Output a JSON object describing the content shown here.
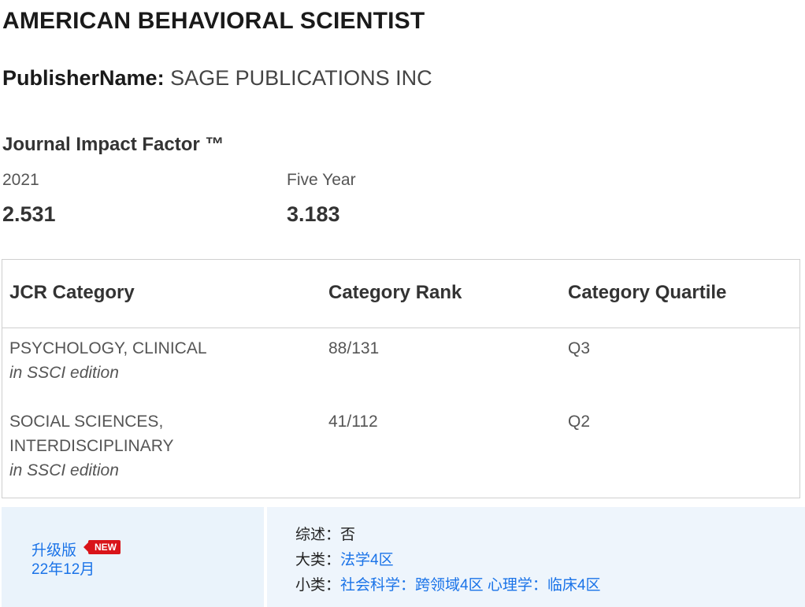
{
  "journal": {
    "title": "AMERICAN BEHAVIORAL SCIENTIST",
    "publisher_label": "PublisherName:",
    "publisher_value": "SAGE PUBLICATIONS INC"
  },
  "impact_factor": {
    "heading": "Journal Impact Factor ™",
    "current": {
      "label": "2021",
      "value": "2.531"
    },
    "five_year": {
      "label": "Five Year",
      "value": "3.183"
    }
  },
  "jcr_table": {
    "headers": [
      "JCR Category",
      "Category Rank",
      "Category Quartile"
    ],
    "rows": [
      {
        "category": "PSYCHOLOGY, CLINICAL",
        "edition": "in SSCI edition",
        "rank": "88/131",
        "quartile": "Q3"
      },
      {
        "category": "SOCIAL SCIENCES, INTERDISCIPLINARY",
        "edition": "in SSCI edition",
        "rank": "41/112",
        "quartile": "Q2"
      }
    ]
  },
  "cas_panel": {
    "upgrade_label": "升级版",
    "badge": "NEW",
    "date": "22年12月",
    "review_label": "综述：",
    "review_value": "否",
    "major_label": "大类：",
    "major_value": "法学4区",
    "minor_label": "小类：",
    "minor_values": [
      "社会科学：跨领域4区",
      "心理学：临床4区"
    ]
  },
  "colors": {
    "link": "#1a73e8",
    "badge": "#d9141a",
    "panel_bg": "#eef5fc"
  }
}
